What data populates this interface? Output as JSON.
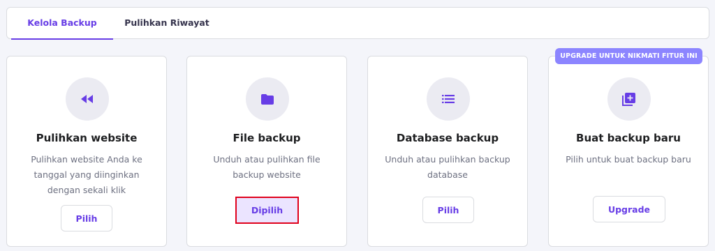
{
  "tabs": [
    {
      "label": "Kelola Backup",
      "active": true
    },
    {
      "label": "Pulihkan Riwayat",
      "active": false
    }
  ],
  "upgrade_ribbon": "UPGRADE UNTUK NIKMATI FITUR INI",
  "cards": [
    {
      "icon": "rewind-icon",
      "title": "Pulihkan website",
      "description": "Pulihkan website Anda ke tanggal yang diinginkan dengan sekali klik",
      "button": "Pilih"
    },
    {
      "icon": "folder-icon",
      "title": "File backup",
      "description": "Unduh atau pulihkan file backup website",
      "button": "Dipilih",
      "selected": true
    },
    {
      "icon": "list-icon",
      "title": "Database backup",
      "description": "Unduh atau pulihkan backup database",
      "button": "Pilih"
    },
    {
      "icon": "add-library-icon",
      "title": "Buat backup baru",
      "description": "Pilih untuk buat backup baru",
      "button": "Upgrade"
    }
  ],
  "colors": {
    "accent": "#673de6",
    "ribbon": "#8c85ff",
    "selected_bg": "#ebe4ff",
    "highlight_border": "#e0001b"
  }
}
